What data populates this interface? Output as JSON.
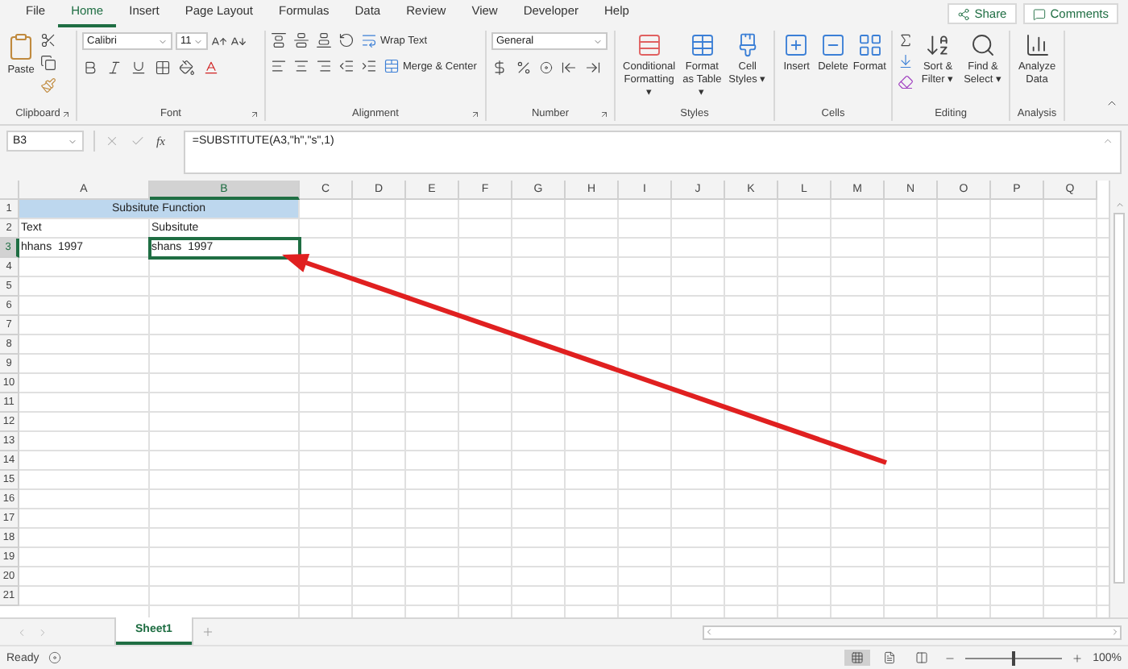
{
  "menu_tabs": [
    {
      "label": "File",
      "selected": false
    },
    {
      "label": "Home",
      "selected": true
    },
    {
      "label": "Insert",
      "selected": false
    },
    {
      "label": "Page Layout",
      "selected": false
    },
    {
      "label": "Formulas",
      "selected": false
    },
    {
      "label": "Data",
      "selected": false
    },
    {
      "label": "Review",
      "selected": false
    },
    {
      "label": "View",
      "selected": false
    },
    {
      "label": "Developer",
      "selected": false
    },
    {
      "label": "Help",
      "selected": false
    }
  ],
  "share_button": "Share",
  "comments_button": "Comments",
  "ribbon": {
    "clipboard": {
      "label": "Clipboard",
      "paste": "Paste"
    },
    "font": {
      "label": "Font",
      "name": "Calibri",
      "size": "11"
    },
    "alignment": {
      "label": "Alignment",
      "wrap": "Wrap Text",
      "merge": "Merge & Center"
    },
    "number": {
      "label": "Number",
      "format": "General"
    },
    "styles": {
      "label": "Styles",
      "buttons": [
        "Conditional Formatting ▾",
        "Format as Table ▾",
        "Cell Styles ▾"
      ]
    },
    "cells": {
      "label": "Cells",
      "buttons": [
        "Insert",
        "Delete",
        "Format"
      ]
    },
    "editing": {
      "label": "Editing",
      "buttons": [
        "Sort & Filter ▾",
        "Find & Select ▾"
      ]
    },
    "analysis": {
      "label": "Analysis",
      "buttons": [
        "Analyze Data"
      ]
    }
  },
  "formula_bar": {
    "name_box": "B3",
    "function_label": "fx",
    "formula": "=SUBSTITUTE(A3,\"h\",\"s\",1)"
  },
  "columns": [
    {
      "label": "A",
      "selected": false
    },
    {
      "label": "B",
      "selected": true
    },
    {
      "label": "C",
      "selected": false
    },
    {
      "label": "D",
      "selected": false
    },
    {
      "label": "E",
      "selected": false
    },
    {
      "label": "F",
      "selected": false
    },
    {
      "label": "G",
      "selected": false
    },
    {
      "label": "H",
      "selected": false
    },
    {
      "label": "I",
      "selected": false
    },
    {
      "label": "J",
      "selected": false
    },
    {
      "label": "K",
      "selected": false
    },
    {
      "label": "L",
      "selected": false
    },
    {
      "label": "M",
      "selected": false
    },
    {
      "label": "N",
      "selected": false
    },
    {
      "label": "O",
      "selected": false
    },
    {
      "label": "P",
      "selected": false
    },
    {
      "label": "Q",
      "selected": false
    }
  ],
  "rows": [
    {
      "header": "1",
      "selected": false,
      "cells": [
        {
          "text": "Subsitute Function",
          "merged": true,
          "shaded": true,
          "active": false
        }
      ]
    },
    {
      "header": "2",
      "selected": false,
      "cells": [
        {
          "text": "Text",
          "merged": false,
          "shaded": false,
          "active": false
        },
        {
          "text": "Subsitute",
          "merged": false,
          "shaded": false,
          "active": false
        }
      ]
    },
    {
      "header": "3",
      "selected": true,
      "cells": [
        {
          "text": "hhans  1997",
          "merged": false,
          "shaded": false,
          "active": false
        },
        {
          "text": "shans  1997",
          "merged": false,
          "shaded": false,
          "active": true
        }
      ]
    },
    {
      "header": "4",
      "selected": false
    },
    {
      "header": "5",
      "selected": false
    },
    {
      "header": "6",
      "selected": false
    },
    {
      "header": "7",
      "selected": false
    },
    {
      "header": "8",
      "selected": false
    },
    {
      "header": "9",
      "selected": false
    },
    {
      "header": "10",
      "selected": false
    },
    {
      "header": "11",
      "selected": false
    },
    {
      "header": "12",
      "selected": false
    },
    {
      "header": "13",
      "selected": false
    },
    {
      "header": "14",
      "selected": false
    },
    {
      "header": "15",
      "selected": false
    },
    {
      "header": "16",
      "selected": false
    },
    {
      "header": "17",
      "selected": false
    },
    {
      "header": "18",
      "selected": false
    },
    {
      "header": "19",
      "selected": false
    },
    {
      "header": "20",
      "selected": false
    },
    {
      "header": "21",
      "selected": false
    }
  ],
  "sheet_tabs": [
    {
      "label": "Sheet1",
      "selected": true
    }
  ],
  "status_bar": {
    "status": "Ready",
    "views": [
      {
        "kind": "normal",
        "selected": true
      },
      {
        "kind": "page-layout",
        "selected": false
      },
      {
        "kind": "page-break",
        "selected": false
      }
    ],
    "zoom": {
      "level": 0.5,
      "reading": "100%"
    }
  }
}
